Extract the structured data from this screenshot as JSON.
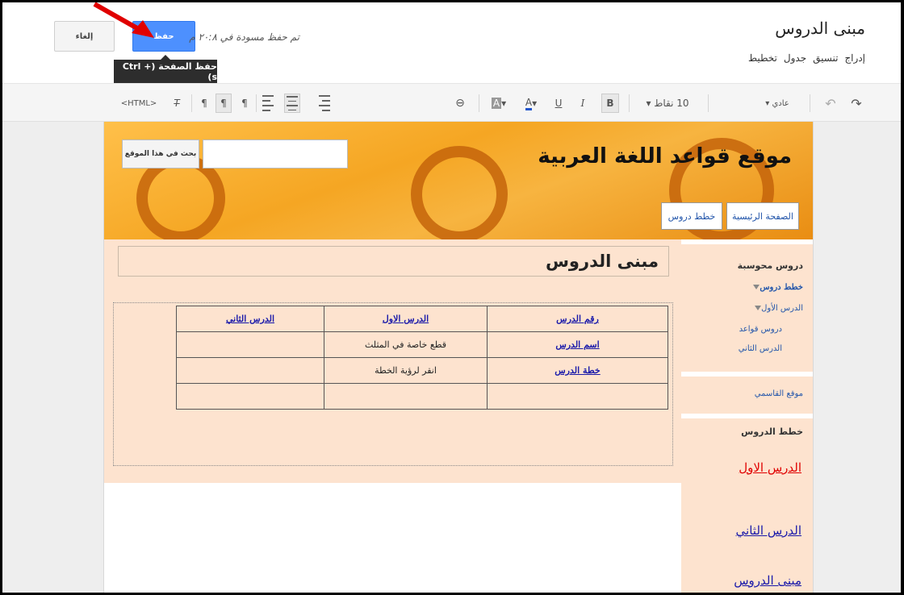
{
  "header": {
    "page_title": "مبنى الدروس",
    "saved_status": "تم حفظ مسودة في ٢٠:٨ م",
    "cancel_label": "إلغاء",
    "save_label": "حفظ",
    "tooltip": "حفظ الصفحة (Ctrl + s)",
    "menu": [
      "إدراج",
      "تنسيق",
      "جدول",
      "تخطيط"
    ]
  },
  "toolbar": {
    "style_label": "عادي",
    "size_label": "10 نقاط",
    "bold": "B",
    "italic": "I",
    "underline": "U",
    "text_color": "A",
    "html_label": "<HTML>"
  },
  "site": {
    "title": "موقع قواعد اللغة العربية",
    "search_button": "بحث في هذا الموقع",
    "nav": [
      "الصفحة الرئيسية",
      "خطط دروس"
    ]
  },
  "content": {
    "title": "مبنى الدروس",
    "table": [
      [
        "رقم الدرس",
        "الدرس الاول",
        "الدرس الثاني"
      ],
      [
        "اسم الدرس",
        "قطع خاصة في المثلث",
        ""
      ],
      [
        "خطة الدرس",
        "انقر لرؤية الخطة",
        ""
      ],
      [
        "",
        "",
        ""
      ]
    ]
  },
  "sidebar": {
    "nav_heading": "دروس محوسبة",
    "nav_items": [
      "خطط دروس",
      "الدرس الأول",
      "دروس قواعد",
      "الدرس الثاني"
    ],
    "external_link": "موقع القاسمي",
    "plans_heading": "خطط الدروس",
    "plans_links": [
      "الدرس الاول",
      "الدرس الثاني",
      "مبنى الدروس"
    ]
  },
  "colors": {
    "save_button": "#4d90fe",
    "banner": "#f5a623",
    "content_bg": "#fde3cf",
    "arrow": "#e00000",
    "link_red": "#e00000",
    "link_blue": "#1a1aaa"
  }
}
